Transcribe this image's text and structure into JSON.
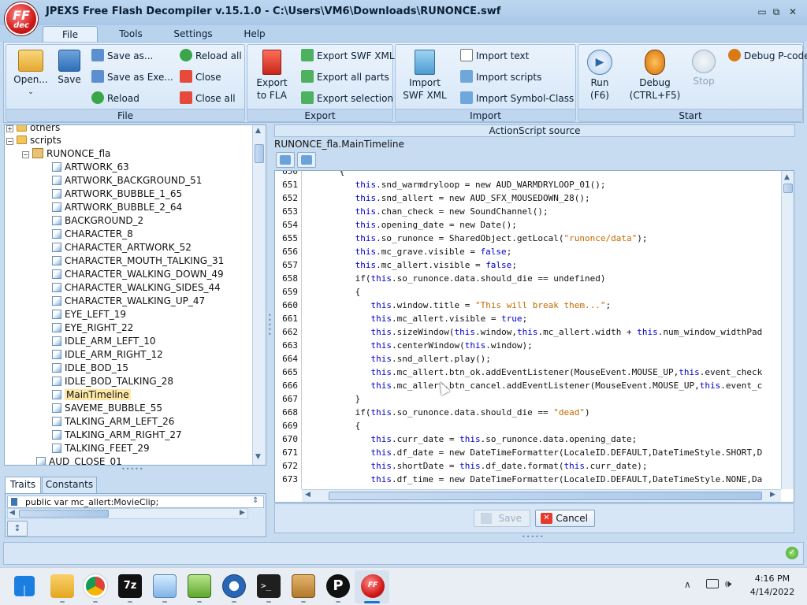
{
  "window": {
    "title": "JPEXS Free Flash Decompiler v.15.1.0 - C:\\Users\\VM6\\Downloads\\RUNONCE.swf",
    "logo_top": "FF",
    "logo_bottom": "dec"
  },
  "menu": [
    "File",
    "Tools",
    "Settings",
    "Help"
  ],
  "ribbon": {
    "file_group": {
      "label": "File",
      "open": "Open...",
      "save": "Save",
      "save_as": "Save as...",
      "save_as_exe": "Save as Exe...",
      "reload": "Reload",
      "reload_all": "Reload all",
      "close": "Close",
      "close_all": "Close all"
    },
    "export_group": {
      "label": "Export",
      "export_fla_1": "Export",
      "export_fla_2": "to FLA",
      "export_swf_xml": "Export SWF XML",
      "export_all_parts": "Export all parts",
      "export_selection": "Export selection"
    },
    "import_group": {
      "label": "Import",
      "import_swf_xml_1": "Import",
      "import_swf_xml_2": "SWF XML",
      "import_text": "Import text",
      "import_scripts": "Import scripts",
      "import_symbol_class": "Import Symbol-Class"
    },
    "start_group": {
      "label": "Start",
      "run_1": "Run",
      "run_2": "(F6)",
      "debug_1": "Debug",
      "debug_2": "(CTRL+F5)",
      "stop": "Stop",
      "debug_pcode": "Debug P-code"
    }
  },
  "tree": {
    "others": "others",
    "scripts": "scripts",
    "runonce_fla": "RUNONCE_fla",
    "items": [
      "ARTWORK_63",
      "ARTWORK_BACKGROUND_51",
      "ARTWORK_BUBBLE_1_65",
      "ARTWORK_BUBBLE_2_64",
      "BACKGROUND_2",
      "CHARACTER_8",
      "CHARACTER_ARTWORK_52",
      "CHARACTER_MOUTH_TALKING_31",
      "CHARACTER_WALKING_DOWN_49",
      "CHARACTER_WALKING_SIDES_44",
      "CHARACTER_WALKING_UP_47",
      "EYE_LEFT_19",
      "EYE_RIGHT_22",
      "IDLE_ARM_LEFT_10",
      "IDLE_ARM_RIGHT_12",
      "IDLE_BOD_15",
      "IDLE_BOD_TALKING_28",
      "MainTimeline",
      "SAVEME_BUBBLE_55",
      "TALKING_ARM_LEFT_26",
      "TALKING_ARM_RIGHT_27",
      "TALKING_FEET_29"
    ],
    "aud_close": "AUD_CLOSE_01"
  },
  "bottom_tabs": {
    "traits": "Traits",
    "constants": "Constants",
    "trait_value": "public var mc_allert:MovieClip;"
  },
  "editor": {
    "header": "ActionScript source",
    "class_path": "RUNONCE_fla.MainTimeline",
    "save": "Save",
    "cancel": "Cancel"
  },
  "code": [
    {
      "ln": "650",
      "t": "      {"
    },
    {
      "ln": "651",
      "t": "         this.snd_warmdryloop = new AUD_WARMDRYLOOP_01();"
    },
    {
      "ln": "652",
      "t": "         this.snd_allert = new AUD_SFX_MOUSEDOWN_28();"
    },
    {
      "ln": "653",
      "t": "         this.chan_check = new SoundChannel();"
    },
    {
      "ln": "654",
      "t": "         this.opening_date = new Date();"
    },
    {
      "ln": "655",
      "t": "         this.so_runonce = SharedObject.getLocal(\"runonce/data\");"
    },
    {
      "ln": "656",
      "t": "         this.mc_grave.visible = false;"
    },
    {
      "ln": "657",
      "t": "         this.mc_allert.visible = false;"
    },
    {
      "ln": "658",
      "t": "         if(this.so_runonce.data.should_die == undefined)"
    },
    {
      "ln": "659",
      "t": "         {"
    },
    {
      "ln": "660",
      "t": "            this.window.title = \"This will break them...\";"
    },
    {
      "ln": "661",
      "t": "            this.mc_allert.visible = true;"
    },
    {
      "ln": "662",
      "t": "            this.sizeWindow(this.window,this.mc_allert.width + this.num_window_widthPad"
    },
    {
      "ln": "663",
      "t": "            this.centerWindow(this.window);"
    },
    {
      "ln": "664",
      "t": "            this.snd_allert.play();"
    },
    {
      "ln": "665",
      "t": "            this.mc_allert.btn_ok.addEventListener(MouseEvent.MOUSE_UP,this.event_check"
    },
    {
      "ln": "666",
      "t": "            this.mc_allert.btn_cancel.addEventListener(MouseEvent.MOUSE_UP,this.event_c"
    },
    {
      "ln": "667",
      "t": "         }"
    },
    {
      "ln": "668",
      "t": "         if(this.so_runonce.data.should_die == \"dead\")"
    },
    {
      "ln": "669",
      "t": "         {"
    },
    {
      "ln": "670",
      "t": "            this.curr_date = this.so_runonce.data.opening_date;"
    },
    {
      "ln": "671",
      "t": "            this.df_date = new DateTimeFormatter(LocaleID.DEFAULT,DateTimeStyle.SHORT,D"
    },
    {
      "ln": "672",
      "t": "            this.shortDate = this.df_date.format(this.curr_date);"
    },
    {
      "ln": "673",
      "t": "            this.df_time = new DateTimeFormatter(LocaleID.DEFAULT,DateTimeStyle.NONE,Da"
    }
  ],
  "taskbar": {
    "time": "4:16 PM",
    "date": "4/14/2022",
    "apps": [
      "windows-start-icon",
      "file-explorer-icon",
      "chrome-icon",
      "7zip-icon",
      "image-viewer-icon",
      "notepad-plus-icon",
      "network-globe-icon",
      "terminal-icon",
      "package-box-icon",
      "p-app-icon",
      "ffdec-icon"
    ]
  }
}
